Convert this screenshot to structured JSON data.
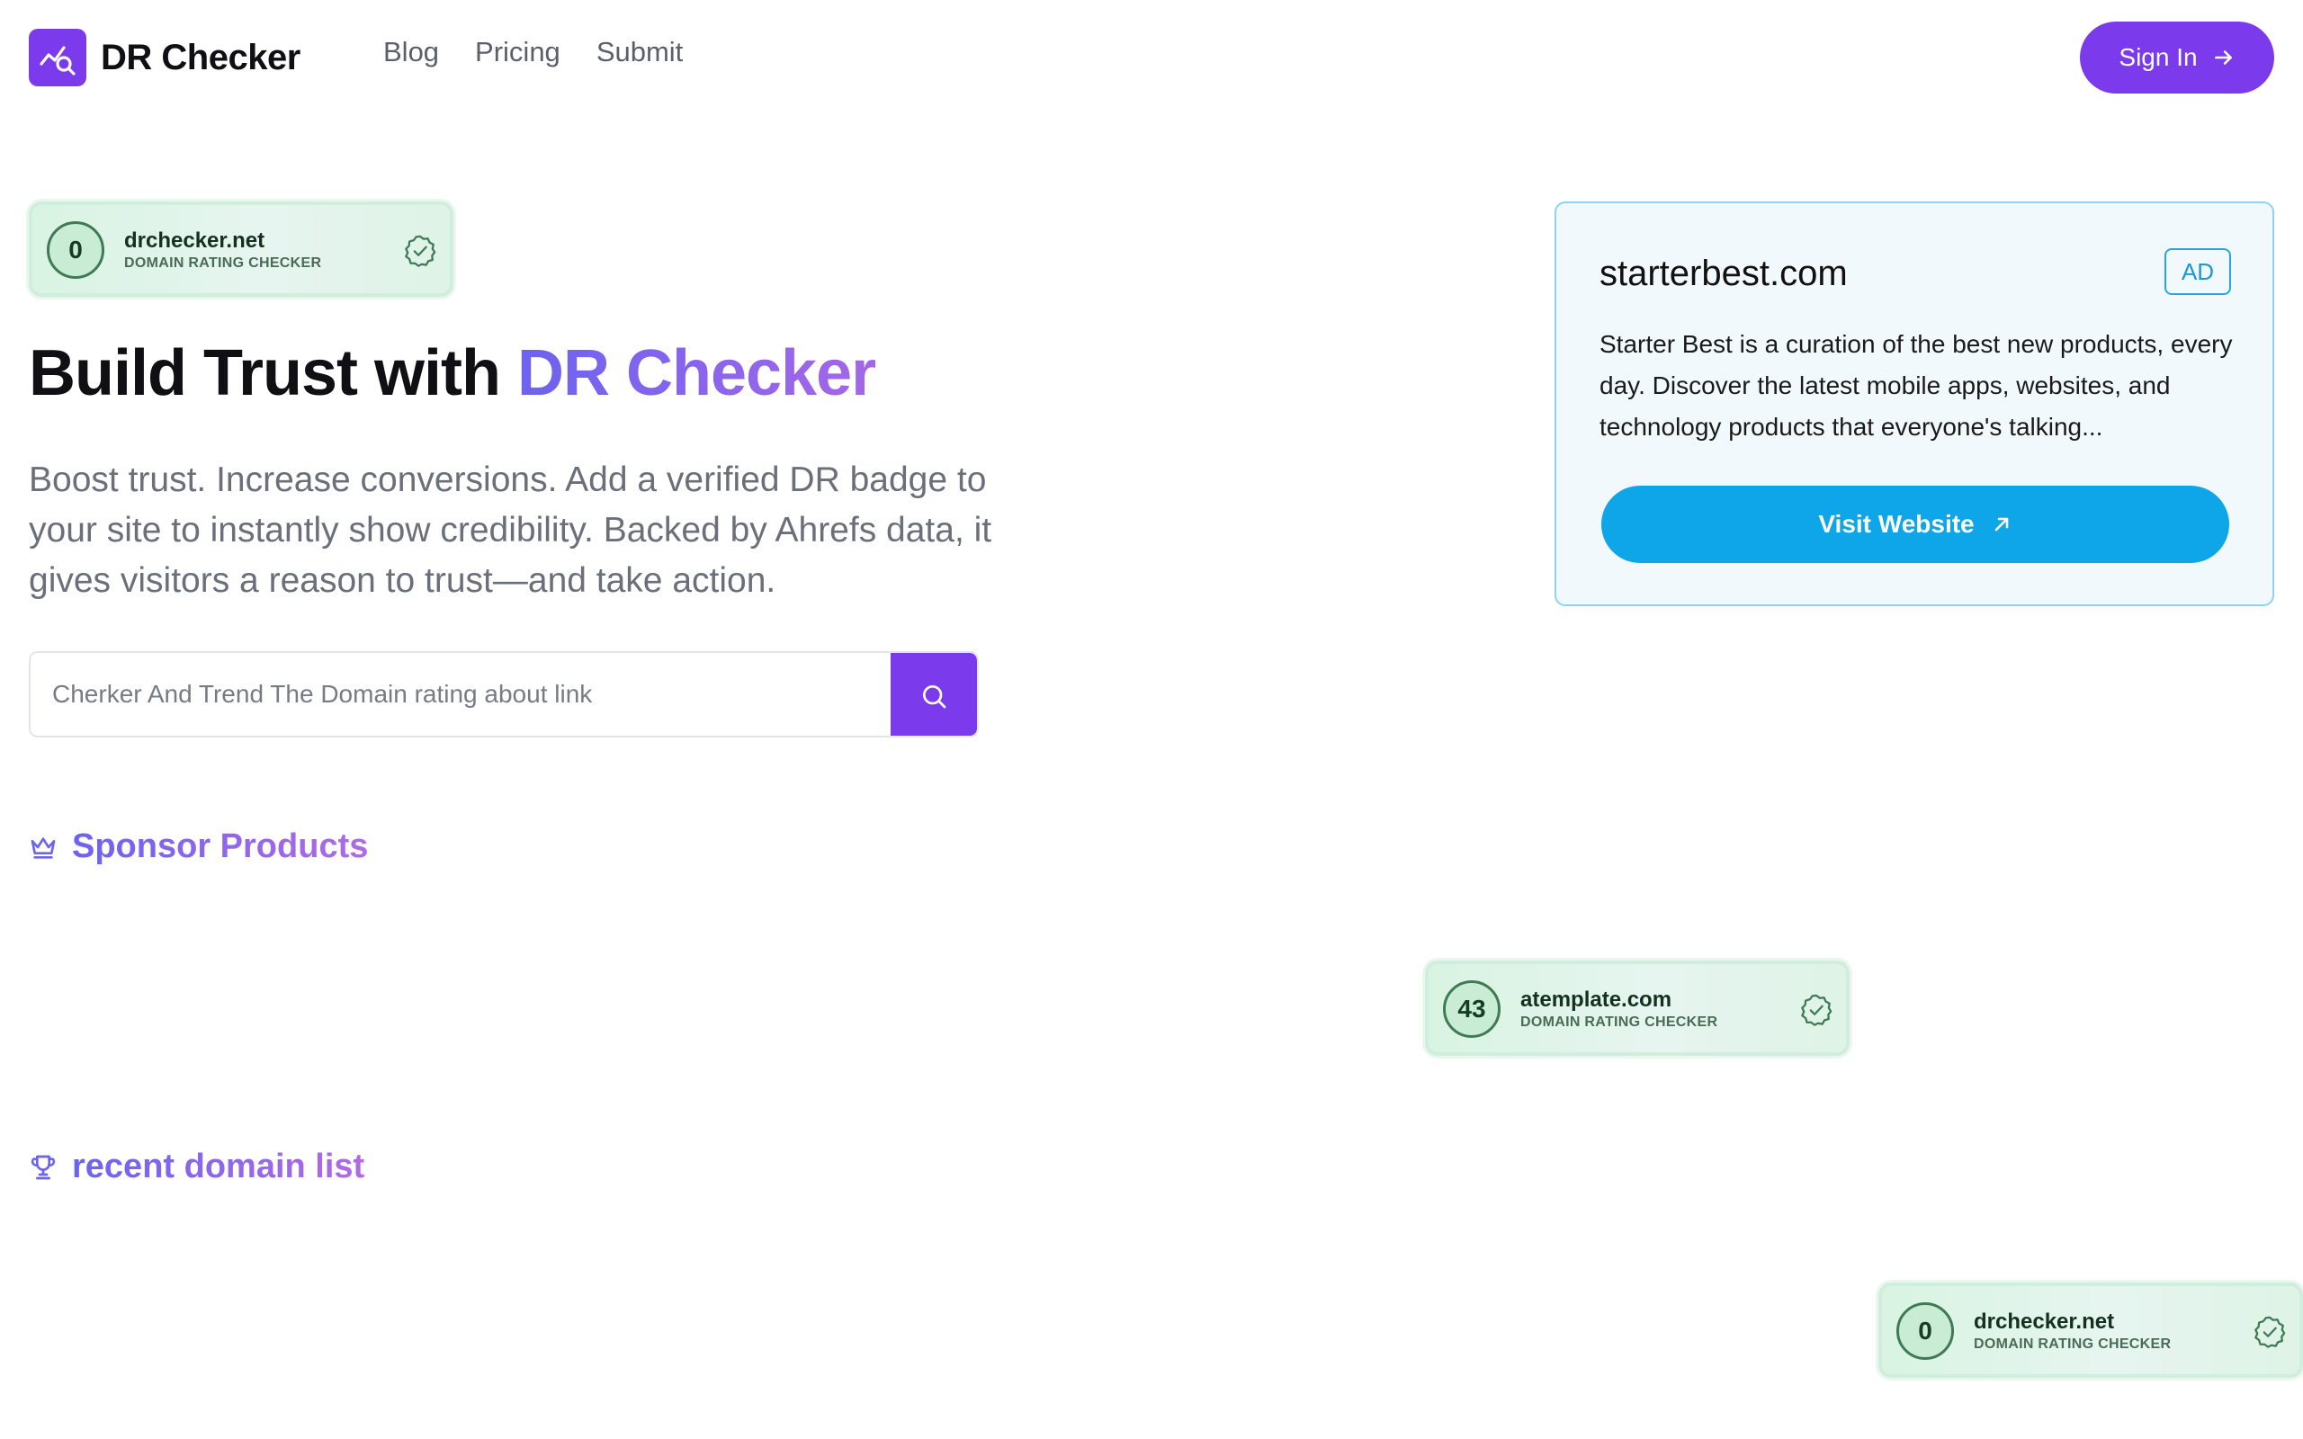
{
  "header": {
    "brand": "DR Checker",
    "nav": [
      "Blog",
      "Pricing",
      "Submit"
    ],
    "signin_label": "Sign In"
  },
  "hero": {
    "title_prefix": "Build Trust with ",
    "title_accent": "DR Checker",
    "description": "Boost trust. Increase conversions. Add a verified DR badge to your site to instantly show credibility. Backed by Ahrefs data, it gives visitors a reason to trust—and take action.",
    "badge": {
      "score": "0",
      "domain": "drchecker.net",
      "subtitle": "DOMAIN RATING CHECKER"
    }
  },
  "search": {
    "placeholder": "Cherker And Trend The Domain rating about link"
  },
  "sections": {
    "sponsor_title": "Sponsor Products",
    "recent_title": "recent domain list"
  },
  "sponsor_badges": [
    {
      "score": "43",
      "domain": "atemplate.com",
      "subtitle": "DOMAIN RATING CHECKER"
    }
  ],
  "recent_badges": [
    {
      "score": "0",
      "domain": "drchecker.net",
      "subtitle": "DOMAIN RATING CHECKER"
    }
  ],
  "ad": {
    "domain": "starterbest.com",
    "tag": "AD",
    "description": "Starter Best is a curation of the best new products, every day. Discover the latest mobile apps, websites, and technology products that everyone's talking...",
    "button_label": "Visit Website"
  },
  "colors": {
    "primary": "#7c3aed",
    "ad_accent": "#0ea5e9",
    "badge_bg": "#d9f4e2"
  },
  "icons": [
    "chart-search-icon",
    "arrow-right-icon",
    "search-icon",
    "crown-icon",
    "trophy-icon",
    "verified-check-icon",
    "external-arrow-icon"
  ]
}
